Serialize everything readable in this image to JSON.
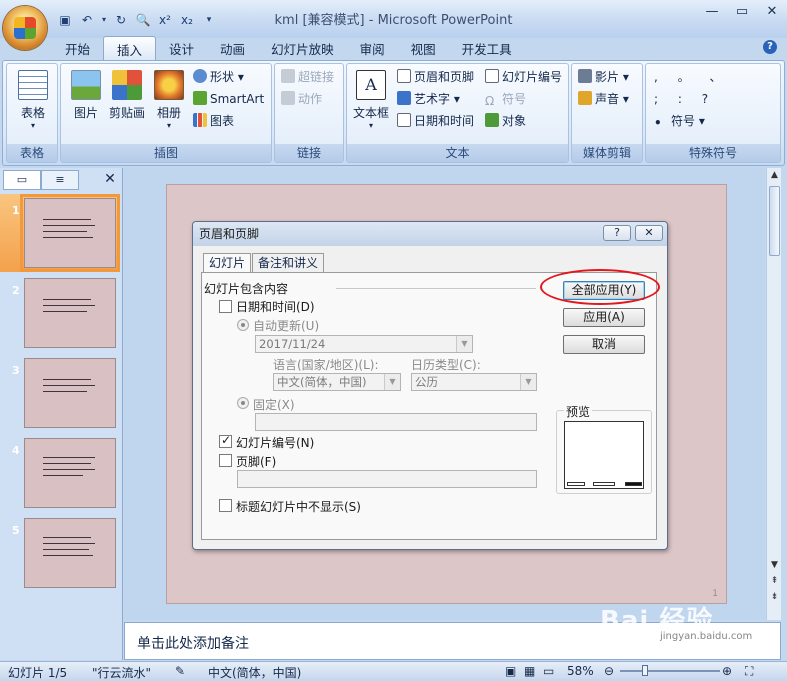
{
  "window": {
    "title": "kml [兼容模式] - Microsoft PowerPoint"
  },
  "qat": {
    "icons": [
      "save-icon",
      "undo-icon",
      "redo-icon",
      "print-preview-icon",
      "superscript-icon",
      "subscript-icon",
      "customize-icon"
    ],
    "sup": "x²",
    "sub": "x₂"
  },
  "tabs": [
    "开始",
    "插入",
    "设计",
    "动画",
    "幻灯片放映",
    "审阅",
    "视图",
    "开发工具"
  ],
  "active_tab": "插入",
  "ribbon": {
    "groups": {
      "table": {
        "label": "表格",
        "btn": "表格"
      },
      "illustrations": {
        "label": "插图",
        "picture": "图片",
        "clipart": "剪贴画",
        "album": "相册",
        "shapes": "形状",
        "smartart": "SmartArt",
        "chart": "图表"
      },
      "links": {
        "label": "链接",
        "hyperlink": "超链接",
        "action": "动作"
      },
      "text": {
        "label": "文本",
        "textbox": "文本框",
        "header_footer": "页眉和页脚",
        "wordart": "艺术字",
        "datetime": "日期和时间",
        "slide_number": "幻灯片编号",
        "symbol": "符号",
        "object": "对象"
      },
      "media": {
        "label": "媒体剪辑",
        "movie": "影片",
        "sound": "声音"
      },
      "special": {
        "label": "特殊符号",
        "row1": ",  。  、",
        "row2": ";  :  ?",
        "symbol": "符号"
      }
    }
  },
  "slides": {
    "numbers": [
      "1",
      "2",
      "3",
      "4",
      "5"
    ],
    "selected": "1"
  },
  "slide_page_number": "1",
  "notes_placeholder": "单击此处添加备注",
  "status": {
    "slide": "幻灯片 1/5",
    "theme": "\"行云流水\"",
    "language": "中文(简体，中国)",
    "zoom": "58%"
  },
  "dialog": {
    "title": "页眉和页脚",
    "help": "?",
    "close": "✕",
    "tab_slide": "幻灯片",
    "tab_notes": "备注和讲义",
    "group_label": "幻灯片包含内容",
    "datetime_label": "日期和时间(D)",
    "datetime_checked": false,
    "auto_update": "自动更新(U)",
    "date_value": "2017/11/24",
    "language_label": "语言(国家/地区)(L):",
    "language_value": "中文(简体，中国)",
    "calendar_label": "日历类型(C):",
    "calendar_value": "公历",
    "fixed_label": "固定(X)",
    "slide_number_label": "幻灯片编号(N)",
    "slide_number_checked": true,
    "footer_label": "页脚(F)",
    "footer_checked": false,
    "title_hide_label": "标题幻灯片中不显示(S)",
    "title_hide_checked": false,
    "apply_all": "全部应用(Y)",
    "apply": "应用(A)",
    "cancel": "取消",
    "preview_label": "预览"
  },
  "watermark": {
    "text": "Bai 经验",
    "url": "jingyan.baidu.com"
  },
  "colors": {
    "accent": "#2b62b9",
    "highlight_circle": "#e2161c",
    "selected_thumb": "#f29a3b"
  }
}
